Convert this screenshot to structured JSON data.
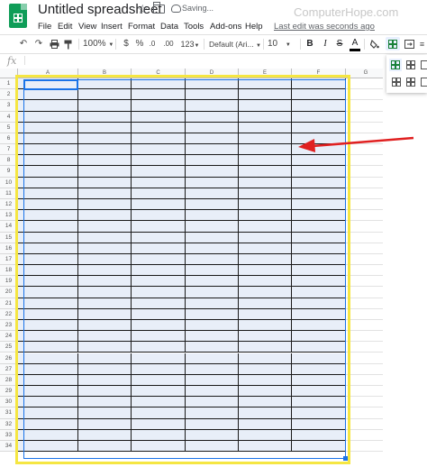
{
  "header": {
    "title": "Untitled spreadsheet",
    "saving": "Saving...",
    "watermark": "ComputerHope.com",
    "last_edit": "Last edit was seconds ago"
  },
  "menu": [
    "File",
    "Edit",
    "View",
    "Insert",
    "Format",
    "Data",
    "Tools",
    "Add-ons",
    "Help"
  ],
  "toolbar": {
    "zoom": "100%",
    "currency": "$",
    "percent": "%",
    "decimal_less": ".0",
    "decimal_more": ".00",
    "more_formats": "123",
    "font": "Default (Ari...",
    "font_size": "10",
    "bold": "B",
    "italic": "I",
    "strike": "S",
    "text_color": "A"
  },
  "formula_bar": {
    "fx": "fx"
  },
  "grid": {
    "columns": [
      "A",
      "B",
      "C",
      "D",
      "E",
      "F",
      "G"
    ],
    "rows": [
      "1",
      "2",
      "3",
      "4",
      "5",
      "6",
      "7",
      "8",
      "9",
      "10",
      "11",
      "12",
      "13",
      "14",
      "15",
      "16",
      "17",
      "18",
      "19",
      "20",
      "21",
      "22",
      "23",
      "24",
      "25",
      "26",
      "27",
      "28",
      "29",
      "30",
      "31",
      "32",
      "33",
      "34"
    ],
    "selected_range": "A1:F34",
    "active_cell": "A1"
  },
  "colors": {
    "accent": "#1a73e8",
    "brand": "#0f9d58",
    "selection_fill": "#e8eef8",
    "highlight": "#f5e642",
    "arrow": "#e02020"
  }
}
